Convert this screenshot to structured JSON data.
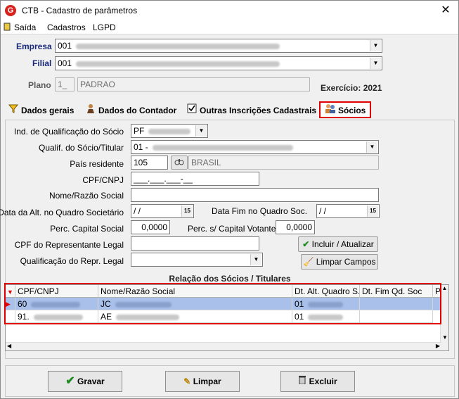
{
  "window": {
    "title": "CTB - Cadastro de parâmetros",
    "close_glyph": "✕"
  },
  "menu": [
    {
      "label": "Saída"
    },
    {
      "label": "Cadastros"
    },
    {
      "label": "LGPD"
    }
  ],
  "header": {
    "empresa_label": "Empresa",
    "empresa_code": "001",
    "filial_label": "Filial",
    "filial_code": "001",
    "plano_label": "Plano",
    "plano_code": "1_",
    "plano_name": "PADRAO",
    "exercicio": "Exercício: 2021"
  },
  "tabs": [
    {
      "label": "Dados gerais",
      "icon": "funnel-icon"
    },
    {
      "label": "Dados do Contador",
      "icon": "person-icon"
    },
    {
      "label": "Outras Inscrições Cadastrais",
      "icon": "checkbox-icon"
    },
    {
      "label": "Sócios",
      "icon": "people-icon",
      "active": true
    }
  ],
  "form": {
    "ind_qualif_label": "Ind. de Qualificação do Sócio",
    "ind_qualif_value": "PF",
    "qualif_socio_label": "Qualif. do Sócio/Titular",
    "qualif_socio_value": "01 -",
    "pais_label": "País residente",
    "pais_code": "105",
    "pais_name": "BRASIL",
    "cpf_label": "CPF/CNPJ",
    "cpf_value": "___.___.___-__",
    "nome_label": "Nome/Razão Social",
    "nome_value": "",
    "data_alt_label": "Data da Alt. no Quadro Societário",
    "data_alt_value": "/ /",
    "data_fim_label": "Data Fim no Quadro Soc.",
    "data_fim_value": "/ /",
    "perc_capital_label": "Perc. Capital Social",
    "perc_capital_value": "0,0000",
    "perc_votante_label": "Perc. s/ Capital Votante",
    "perc_votante_value": "0,0000",
    "cpf_repr_label": "CPF do Representante Legal",
    "cpf_repr_value": "",
    "qualif_repr_label": "Qualificação do Repr. Legal",
    "qualif_repr_value": "",
    "cal_glyph": "15"
  },
  "actions": {
    "incluir": "Incluir / Atualizar",
    "limpar_campos": "Limpar Campos"
  },
  "grid": {
    "title": "Relação dos Sócios / Titulares",
    "columns": [
      "CPF/CNPJ",
      "Nome/Razão Social",
      "Dt. Alt. Quadro S...",
      "Dt. Fim Qd. Soc",
      "P"
    ],
    "rows": [
      {
        "cpf": "60",
        "nome": "JC",
        "dt_alt": "01",
        "dt_fim": ""
      },
      {
        "cpf": "91.",
        "nome": "AE",
        "dt_alt": "01",
        "dt_fim": ""
      }
    ]
  },
  "bottom": {
    "gravar": "Gravar",
    "limpar": "Limpar",
    "excluir": "Excluir"
  },
  "colors": {
    "accent_red": "#e10000",
    "label_blue": "#1b2a7a",
    "row_selected": "#a9c1ea"
  }
}
